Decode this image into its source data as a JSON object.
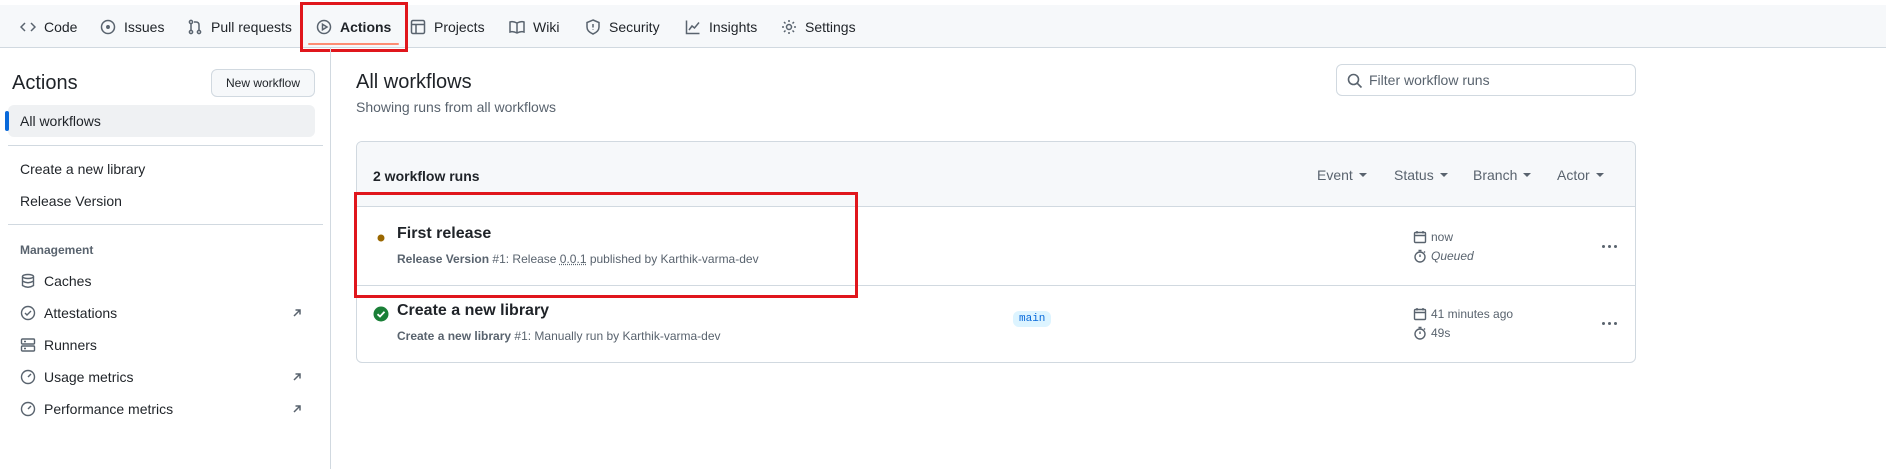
{
  "nav": {
    "items": [
      {
        "label": "Code",
        "icon": "code-icon"
      },
      {
        "label": "Issues",
        "icon": "issue-icon"
      },
      {
        "label": "Pull requests",
        "icon": "pull-request-icon"
      },
      {
        "label": "Actions",
        "icon": "play-icon",
        "active": true
      },
      {
        "label": "Projects",
        "icon": "table-icon"
      },
      {
        "label": "Wiki",
        "icon": "book-icon"
      },
      {
        "label": "Security",
        "icon": "shield-icon"
      },
      {
        "label": "Insights",
        "icon": "graph-icon"
      },
      {
        "label": "Settings",
        "icon": "gear-icon"
      }
    ]
  },
  "sidebar": {
    "title": "Actions",
    "new_workflow_label": "New workflow",
    "all_workflows_label": "All workflows",
    "workflows": [
      {
        "label": "Create a new library"
      },
      {
        "label": "Release Version"
      }
    ],
    "management_heading": "Management",
    "management": [
      {
        "label": "Caches",
        "icon": "database-icon",
        "external": false
      },
      {
        "label": "Attestations",
        "icon": "verified-icon",
        "external": true
      },
      {
        "label": "Runners",
        "icon": "server-icon",
        "external": false
      },
      {
        "label": "Usage metrics",
        "icon": "meter-icon",
        "external": true
      },
      {
        "label": "Performance metrics",
        "icon": "meter-icon",
        "external": true
      }
    ]
  },
  "main": {
    "title": "All workflows",
    "subtitle": "Showing runs from all workflows",
    "filter_placeholder": "Filter workflow runs",
    "runs_count": "2 workflow runs",
    "filters": [
      "Event",
      "Status",
      "Branch",
      "Actor"
    ],
    "runs": [
      {
        "title": "First release",
        "workflow": "Release Version",
        "number": "#1",
        "meta_pre": ": Release ",
        "version": "0.0.1",
        "meta_post": " published by Karthik-varma-dev",
        "status": "queued",
        "branch": "",
        "time": "now",
        "duration": "Queued"
      },
      {
        "title": "Create a new library",
        "workflow": "Create a new library",
        "number": "#1",
        "meta_pre": ": Manually run by Karthik-varma-dev",
        "version": "",
        "meta_post": "",
        "status": "success",
        "branch": "main",
        "time": "41 minutes ago",
        "duration": "49s"
      }
    ]
  },
  "colors": {
    "accent": "#0969da",
    "highlight_box": "#e0161c",
    "success": "#1a7f37",
    "queued": "#9a6700"
  }
}
